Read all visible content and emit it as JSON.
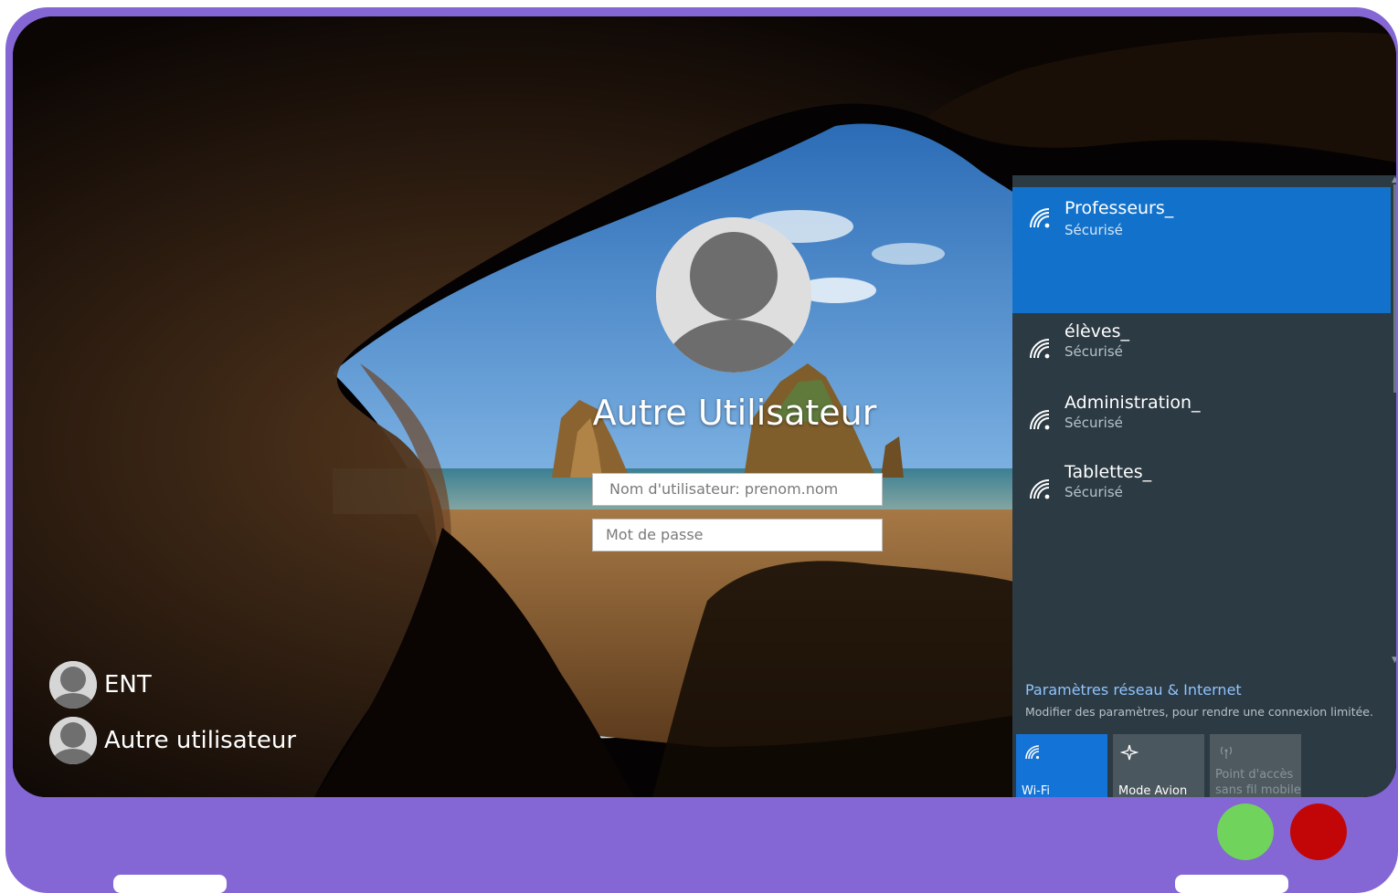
{
  "login": {
    "user_title": "Autre Utilisateur",
    "username_placeholder": "Nom d'utilisateur: prenom.nom",
    "password_placeholder": "Mot de passe"
  },
  "users": [
    {
      "label": "ENT"
    },
    {
      "label": "Autre utilisateur"
    }
  ],
  "network": {
    "items": [
      {
        "ssid": "Professeurs_",
        "status": "Sécurisé",
        "selected": true
      },
      {
        "ssid": "élèves_",
        "status": "Sécurisé",
        "selected": false
      },
      {
        "ssid": "Administration_",
        "status": "Sécurisé",
        "selected": false
      },
      {
        "ssid": "Tablettes_",
        "status": "Sécurisé",
        "selected": false
      }
    ],
    "settings_link": "Paramètres réseau & Internet",
    "settings_desc": "Modifier des paramètres, pour rendre une connexion limitée.",
    "tiles": {
      "wifi": "Wi-Fi",
      "avion": "Mode Avion",
      "hotspot_line1": "Point d'accès",
      "hotspot_line2": "sans fil mobile"
    }
  },
  "colors": {
    "frame": "#8466d4",
    "accent": "#1272cb",
    "panel": "#2c3a43",
    "green_dot": "#6fd35c",
    "red_dot": "#c20607"
  }
}
